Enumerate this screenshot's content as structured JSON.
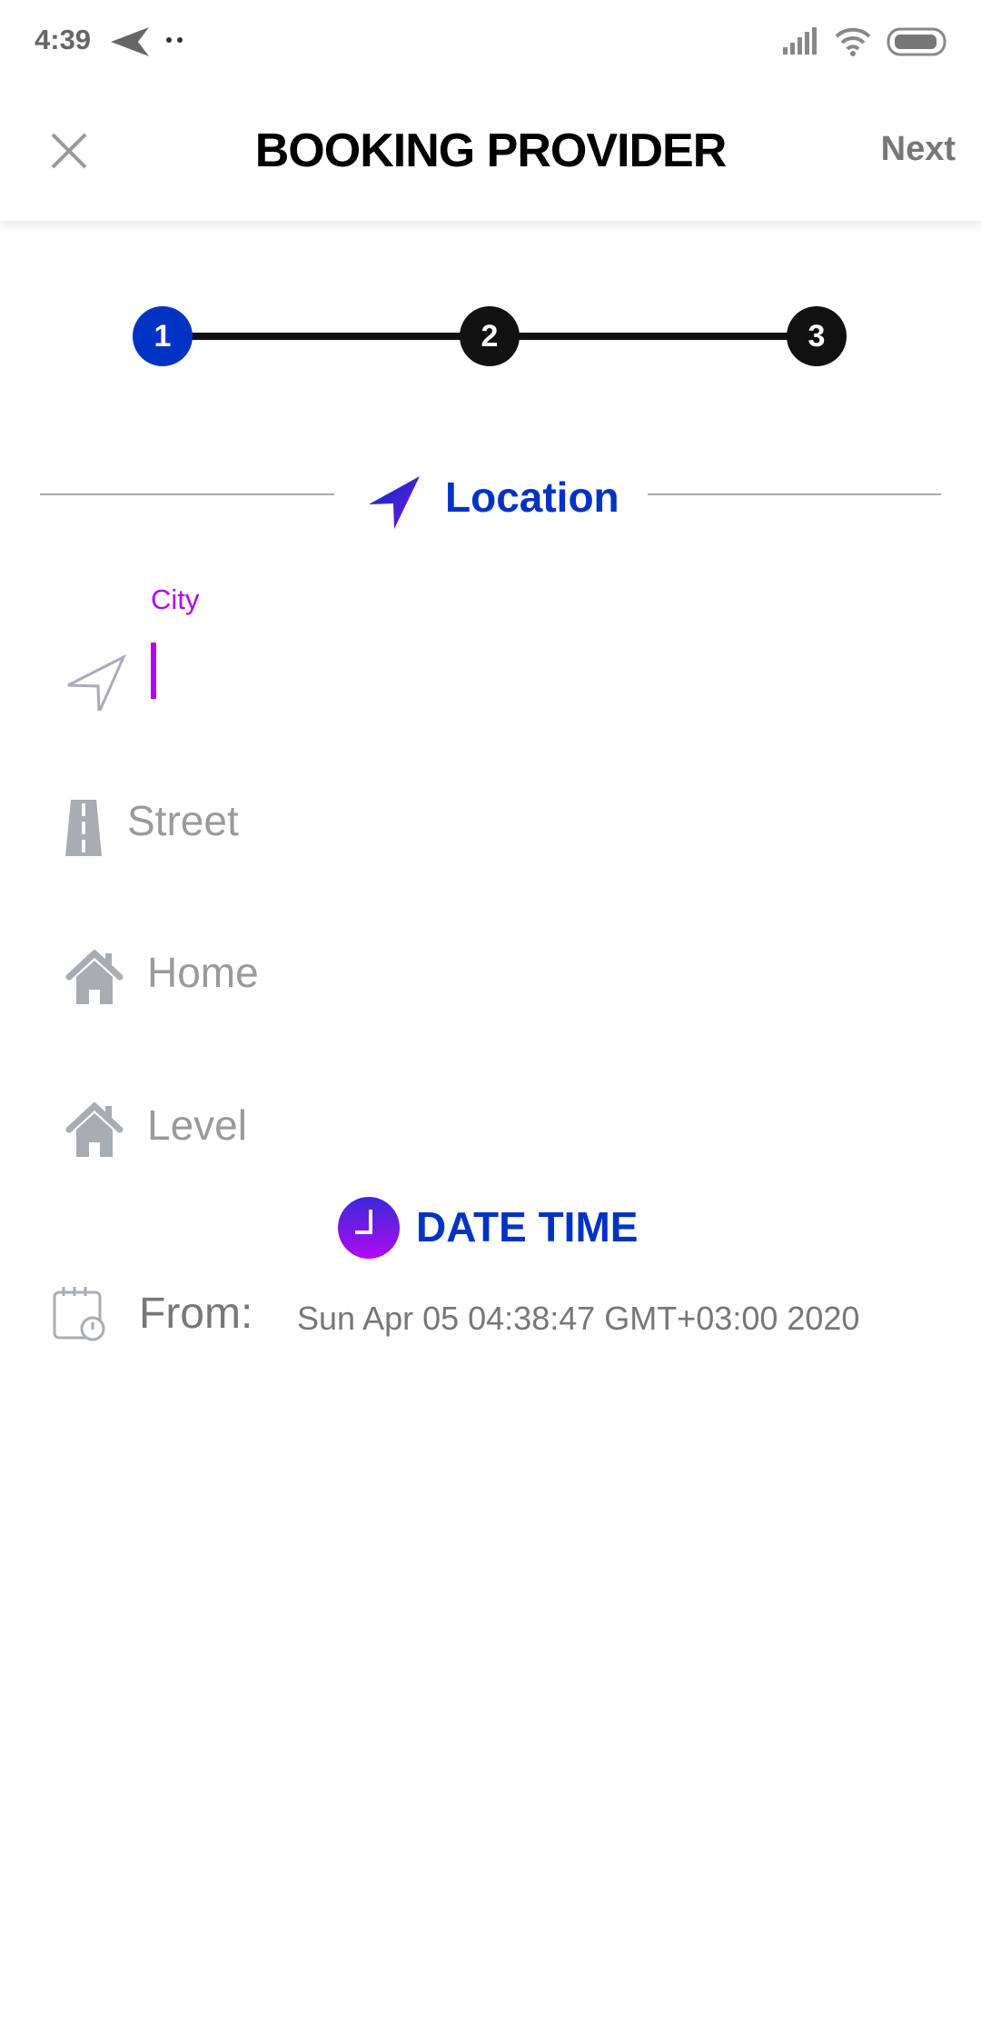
{
  "status_bar": {
    "time": "4:39",
    "icons": [
      "telegram-icon",
      "more-dots-icon",
      "signal-icon",
      "wifi-icon",
      "battery-icon"
    ]
  },
  "app_bar": {
    "title": "BOOKING PROVIDER",
    "next_label": "Next",
    "close_icon": "close-icon"
  },
  "stepper": {
    "steps": [
      "1",
      "2",
      "3"
    ],
    "active_step": 1,
    "active_color": "#0033c4"
  },
  "location": {
    "heading": "Location",
    "city_label": "City",
    "city_value": "",
    "street_placeholder": "Street",
    "home_placeholder": "Home",
    "level_placeholder": "Level"
  },
  "date_time": {
    "heading": "DATE TIME",
    "from_label": "From:",
    "from_value": "Sun Apr 05 04:38:47 GMT+03:00 2020"
  },
  "colors": {
    "accent": "#0033c4",
    "focus": "#b300f0",
    "muted": "#9a9a9a"
  }
}
